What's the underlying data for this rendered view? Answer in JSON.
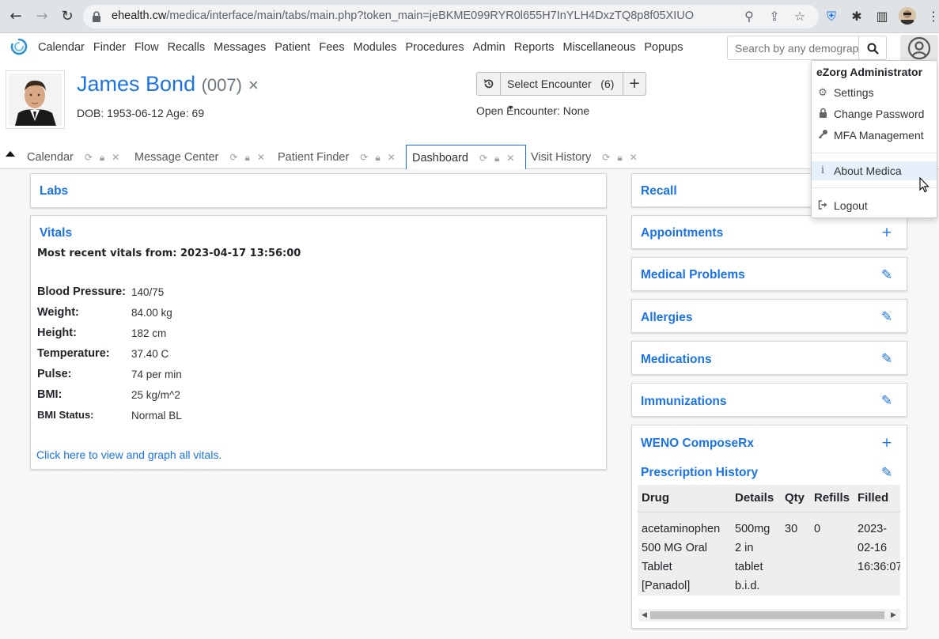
{
  "browser": {
    "url_host": "ehealth.cw",
    "url_path": "/medica/interface/main/tabs/main.php?token_main=jeBKME099RYR0l655H7InYLH4DxzTQ8p8f05XIUO"
  },
  "nav": {
    "items": [
      "Calendar",
      "Finder",
      "Flow",
      "Recalls",
      "Messages",
      "Patient",
      "Fees",
      "Modules",
      "Procedures",
      "Admin",
      "Reports",
      "Miscellaneous",
      "Popups"
    ],
    "search_placeholder": "Search by any demographics"
  },
  "patient": {
    "name": "James Bond",
    "pid": "(007)",
    "close": "×",
    "dob_line": "DOB: 1953-06-12 Age: 69"
  },
  "encounter": {
    "select_label": "Select Encounter",
    "count": "(6)",
    "add": "+",
    "open_encounter": "Open Encounter: None"
  },
  "tabs": [
    {
      "label": "Calendar"
    },
    {
      "label": "Message Center"
    },
    {
      "label": "Patient Finder"
    },
    {
      "label": "Dashboard"
    },
    {
      "label": "Visit History"
    }
  ],
  "cards": {
    "labs": "Labs",
    "vitals": {
      "title": "Vitals",
      "heading": "Most recent vitals from: 2023-04-17 13:56:00",
      "rows": [
        {
          "label": "Blood Pressure:",
          "value": "140/75"
        },
        {
          "label": "Weight:",
          "value": "84.00 kg"
        },
        {
          "label": "Height:",
          "value": "182 cm"
        },
        {
          "label": "Temperature:",
          "value": "37.40 C"
        },
        {
          "label": "Pulse:",
          "value": "74 per min"
        },
        {
          "label": "BMI:",
          "value": "25 kg/m^2"
        },
        {
          "label": "BMI Status:",
          "value": "Normal BL"
        }
      ],
      "link": "Click here to view and graph all vitals."
    },
    "right": [
      "Recall",
      "Appointments",
      "Medical Problems",
      "Allergies",
      "Medications",
      "Immunizations",
      "WENO ComposeRx",
      "Prescription History"
    ]
  },
  "prescriptions": {
    "headers": [
      "Drug",
      "Details",
      "Qty",
      "Refills",
      "Filled"
    ],
    "row": {
      "drug": "acetaminophen\n500 MG Oral\nTablet\n[Panadol]",
      "details": "500mg\n2 in\ntablet\nb.i.d.",
      "qty": "30",
      "refills": "0",
      "filled": "2023-\n02-16\n16:36:07"
    }
  },
  "user_menu": {
    "header": "eZorg Administrator",
    "items": [
      "Settings",
      "Change Password",
      "MFA Management",
      "About Medica",
      "Logout"
    ]
  },
  "colors": {
    "link": "#1a73e8",
    "active_tab_border": "#0d6efd",
    "menu_highlight": "#e6f0fb"
  }
}
